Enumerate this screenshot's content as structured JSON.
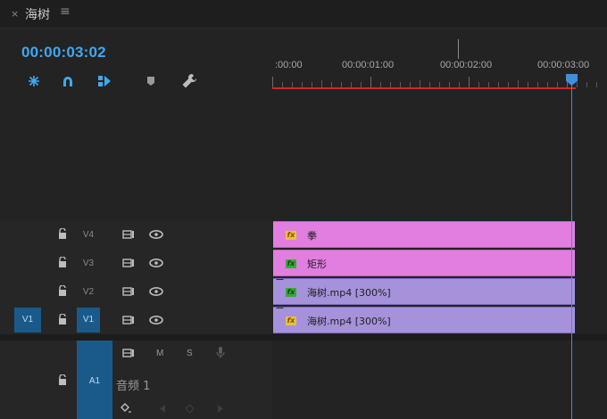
{
  "tab": {
    "close": "×",
    "title": "海树",
    "menu": "≡"
  },
  "timecode": "00:00:03:02",
  "tools": [
    "snap-icon",
    "magnet-icon",
    "linked-selection-icon",
    "marker-icon",
    "wrench-icon"
  ],
  "ruler": {
    "labels": [
      ":00:00",
      "00:00:01:00",
      "00:00:02:00",
      "00:00:03:00"
    ]
  },
  "video_tracks": [
    {
      "name": "V4",
      "clip": {
        "label": "拳",
        "fx": "fx",
        "fx_color": "yellow",
        "color": "pink"
      }
    },
    {
      "name": "V3",
      "clip": {
        "label": "矩形",
        "fx": "fx",
        "fx_color": "green",
        "color": "pink"
      }
    },
    {
      "name": "V2",
      "clip": {
        "label": "海树.mp4 [300%]",
        "fx": "fx",
        "fx_color": "green",
        "color": "purple"
      }
    },
    {
      "name": "V1",
      "source": "V1",
      "clip": {
        "label": "海树.mp4 [300%]",
        "fx": "fx",
        "fx_color": "yellow",
        "color": "purple"
      }
    }
  ],
  "audio_track": {
    "name": "A1",
    "mute": "M",
    "solo": "S",
    "label": "音频 1"
  },
  "colors": {
    "accent": "#3fa8f2",
    "playhead": "#3f8fe0",
    "work_area": "#d4262a",
    "clip_pink": "#e17ee0",
    "clip_purple": "#a592db"
  }
}
